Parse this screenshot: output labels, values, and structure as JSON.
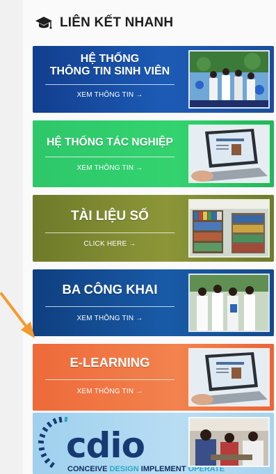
{
  "section": {
    "title": "LIÊN KẾT NHANH",
    "icon": "graduation-cap-icon"
  },
  "banners": [
    {
      "title_line1": "HỆ THỐNG",
      "title_line2": "THÔNG TIN SINH VIÊN",
      "cta": "XEM THÔNG TIN →",
      "color": "#1c5bb5",
      "photo": "students-graduation-photo"
    },
    {
      "title": "HỆ THỐNG TÁC NGHIỆP",
      "cta": "XEM THÔNG TIN →",
      "color": "#33d36f",
      "photo": "laptop-photo"
    },
    {
      "title": "TÀI LIỆU SỐ",
      "cta": "CLICK HERE →",
      "color": "#8c9638",
      "photo": "library-shelves-photo"
    },
    {
      "title": "BA CÔNG KHAI",
      "cta": "XEM THÔNG TIN →",
      "color": "#195aa7",
      "photo": "students-uniform-photo"
    },
    {
      "title": "E-LEARNING",
      "cta": "XEM THÔNG TIN →",
      "color": "#f2834e",
      "photo": "laptop-photo"
    },
    {
      "logo": "cdio",
      "tagline": [
        "CONCEIVE",
        "DESIGN",
        "IMPLEMENT",
        "OPERATE"
      ],
      "color": "#b8ddf3",
      "photo": "students-lab-photo"
    }
  ],
  "annotation_arrow_color": "#f39a2f"
}
